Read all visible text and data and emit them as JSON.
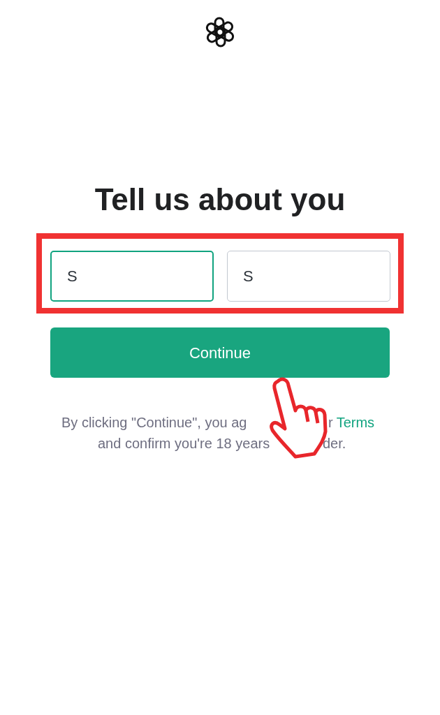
{
  "heading": "Tell us about you",
  "fields": [
    {
      "value": "S",
      "focused": true
    },
    {
      "value": "S",
      "focused": false
    }
  ],
  "button": {
    "label": "Continue"
  },
  "terms_note": {
    "lines": [
      {
        "before": "By clicking \"Continue\", you ag",
        "after": "r",
        "link": "Terms"
      },
      {
        "before": "and confirm you're 18 years",
        "after": "der."
      }
    ]
  }
}
